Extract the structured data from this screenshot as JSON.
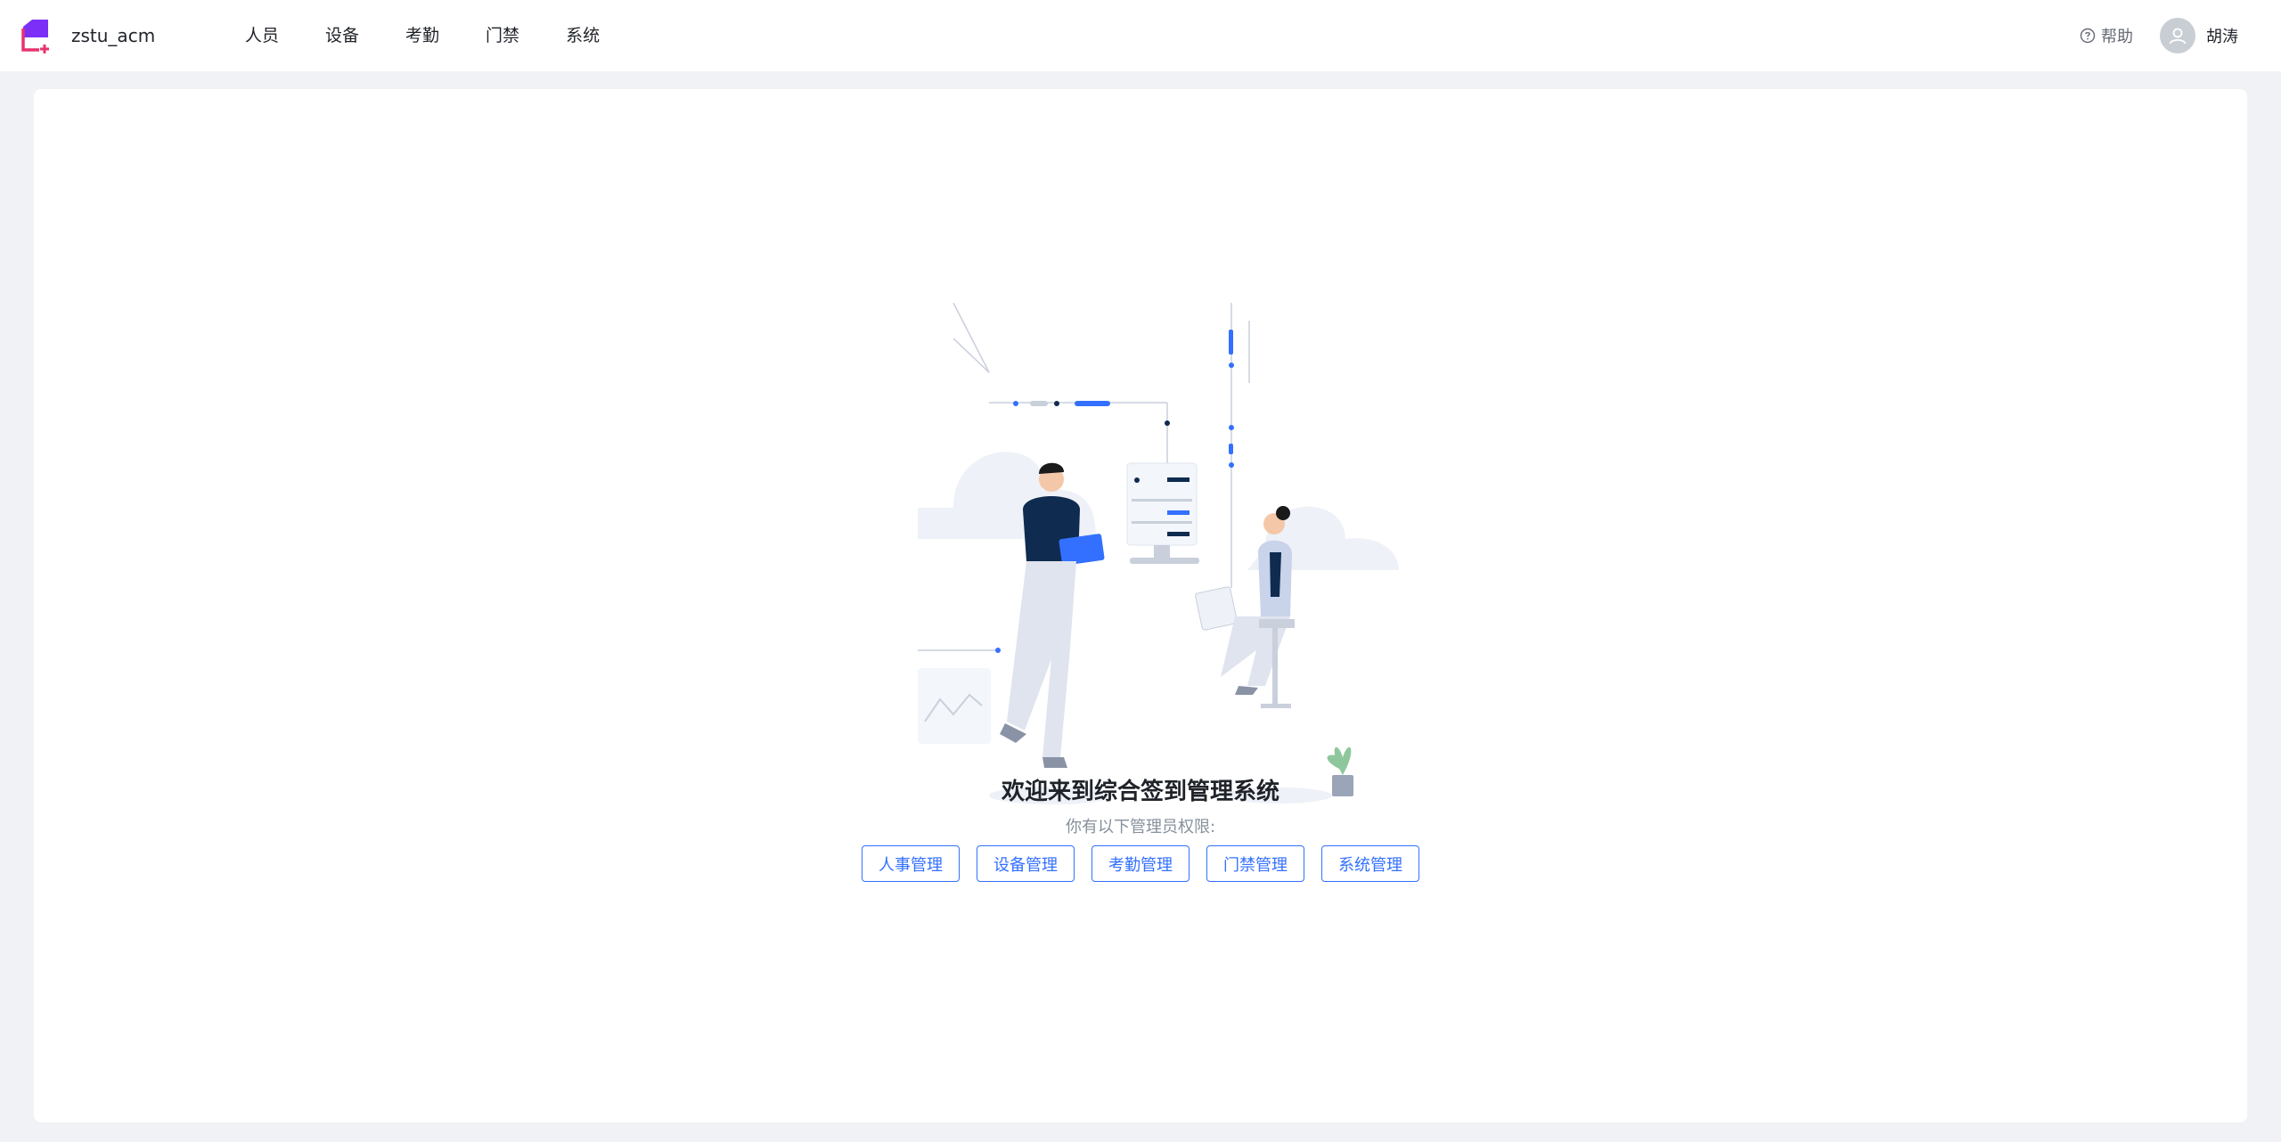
{
  "header": {
    "app_name": "zstu_acm",
    "nav": [
      "人员",
      "设备",
      "考勤",
      "门禁",
      "系统"
    ],
    "help_label": "帮助",
    "username": "胡涛"
  },
  "main": {
    "welcome_title": "欢迎来到综合签到管理系统",
    "permission_text": "你有以下管理员权限:",
    "permissions": [
      "人事管理",
      "设备管理",
      "考勤管理",
      "门禁管理",
      "系统管理"
    ]
  },
  "colors": {
    "accent": "#3370ff",
    "logo_primary": "#7b2ff7",
    "logo_secondary": "#e8336d"
  },
  "icons": {
    "logo": "app-logo",
    "help": "question-circle-icon",
    "avatar": "user-avatar-icon"
  }
}
